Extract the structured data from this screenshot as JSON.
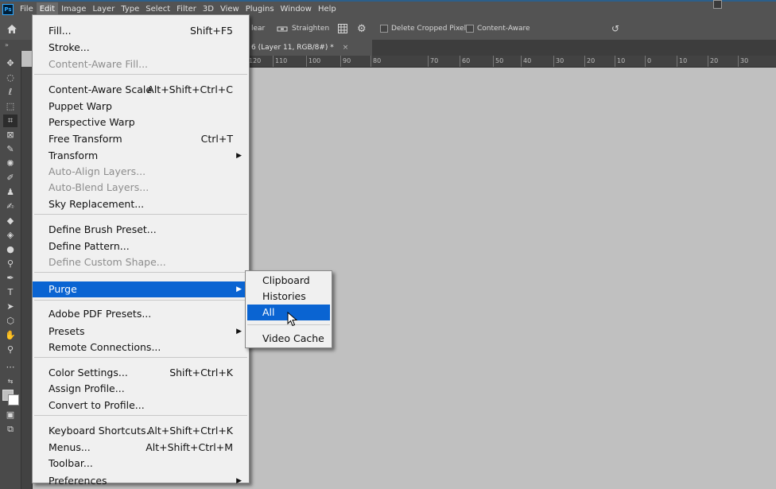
{
  "app": {
    "logo": "Ps",
    "menubar": [
      "File",
      "Edit",
      "Image",
      "Layer",
      "Type",
      "Select",
      "Filter",
      "3D",
      "View",
      "Plugins",
      "Window",
      "Help"
    ],
    "active_menu": "Edit"
  },
  "options_bar": {
    "clear_label": "lear",
    "straighten_label": "Straighten",
    "delete_cropped_label": "Delete Cropped Pixels",
    "content_aware_label": "Content-Aware"
  },
  "panel_arrows": "»",
  "document_tab": {
    "title": "6 (Layer 11, RGB/8#) *",
    "close": "×"
  },
  "ruler": {
    "labels": [
      "120",
      "110",
      "100",
      "90",
      "80",
      "70",
      "60",
      "50",
      "40",
      "30",
      "20",
      "10",
      "0",
      "10",
      "20",
      "30"
    ]
  },
  "edit_menu": {
    "items": [
      {
        "label": "Fill...",
        "shortcut": "Shift+F5"
      },
      {
        "label": "Stroke..."
      },
      {
        "label": "Content-Aware Fill...",
        "disabled": true
      },
      {
        "label": "Content-Aware Scale",
        "shortcut": "Alt+Shift+Ctrl+C"
      },
      {
        "label": "Puppet Warp"
      },
      {
        "label": "Perspective Warp"
      },
      {
        "label": "Free Transform",
        "shortcut": "Ctrl+T"
      },
      {
        "label": "Transform",
        "arrow": "▶"
      },
      {
        "label": "Auto-Align Layers...",
        "disabled": true
      },
      {
        "label": "Auto-Blend Layers...",
        "disabled": true
      },
      {
        "label": "Sky Replacement..."
      },
      {
        "label": "Define Brush Preset..."
      },
      {
        "label": "Define Pattern..."
      },
      {
        "label": "Define Custom Shape...",
        "disabled": true
      },
      {
        "label": "Purge",
        "arrow": "▶",
        "highlight": true
      },
      {
        "label": "Adobe PDF Presets..."
      },
      {
        "label": "Presets",
        "arrow": "▶"
      },
      {
        "label": "Remote Connections..."
      },
      {
        "label": "Color Settings...",
        "shortcut": "Shift+Ctrl+K"
      },
      {
        "label": "Assign Profile..."
      },
      {
        "label": "Convert to Profile..."
      },
      {
        "label": "Keyboard Shortcuts...",
        "shortcut": "Alt+Shift+Ctrl+K"
      },
      {
        "label": "Menus...",
        "shortcut": "Alt+Shift+Ctrl+M"
      },
      {
        "label": "Toolbar..."
      },
      {
        "label": "Preferences",
        "arrow": "▶"
      }
    ]
  },
  "purge_submenu": {
    "items": [
      {
        "label": "Clipboard"
      },
      {
        "label": "Histories"
      },
      {
        "label": "All",
        "highlight": true
      },
      {
        "label": "Video Cache"
      }
    ]
  },
  "colors": {
    "highlight": "#0a64d2",
    "menu_bg": "#f0f0f0",
    "canvas_bg": "#c0c0c0",
    "ui_bg": "#535353"
  }
}
